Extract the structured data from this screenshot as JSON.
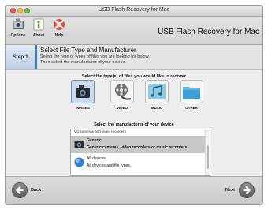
{
  "window": {
    "title": "USB Flash Recovery for Mac"
  },
  "toolbar": {
    "options_label": "Options",
    "about_label": "About",
    "help_label": "Help",
    "app_title": "USB Flash Recovery for Mac"
  },
  "step": {
    "badge": "Step 1",
    "heading": "Select File Type and Manufacturer",
    "desc_line1": "Select the type or types of files you are looking for below.",
    "desc_line2": "Then select the manufacturer of your device."
  },
  "file_types": {
    "prompt": "Select the type(s) of files you would like to recover",
    "items": [
      {
        "label": "IMAGES",
        "selected": true,
        "icon": "camera-icon"
      },
      {
        "label": "VIDEO",
        "selected": false,
        "icon": "film-reel-icon"
      },
      {
        "label": "MUSIC",
        "selected": false,
        "icon": "music-notes-icon"
      },
      {
        "label": "OTHER",
        "selected": false,
        "icon": "folder-icon"
      }
    ]
  },
  "manufacturer": {
    "prompt": "Select the manufacturer of your device",
    "partial_top": "VQ cameras and video recorders",
    "items": [
      {
        "name": "Generic",
        "desc": "Generic cameras, video recorders or music recorders.",
        "selected": true,
        "icon": "camera-icon"
      },
      {
        "name": "All devices",
        "desc": "All devices and file types.",
        "selected": false,
        "icon": "globe-icon"
      }
    ]
  },
  "nav": {
    "back_label": "Back",
    "next_label": "Next"
  },
  "colors": {
    "accent": "#3b7bd1",
    "selection": "#c7c7c7"
  }
}
